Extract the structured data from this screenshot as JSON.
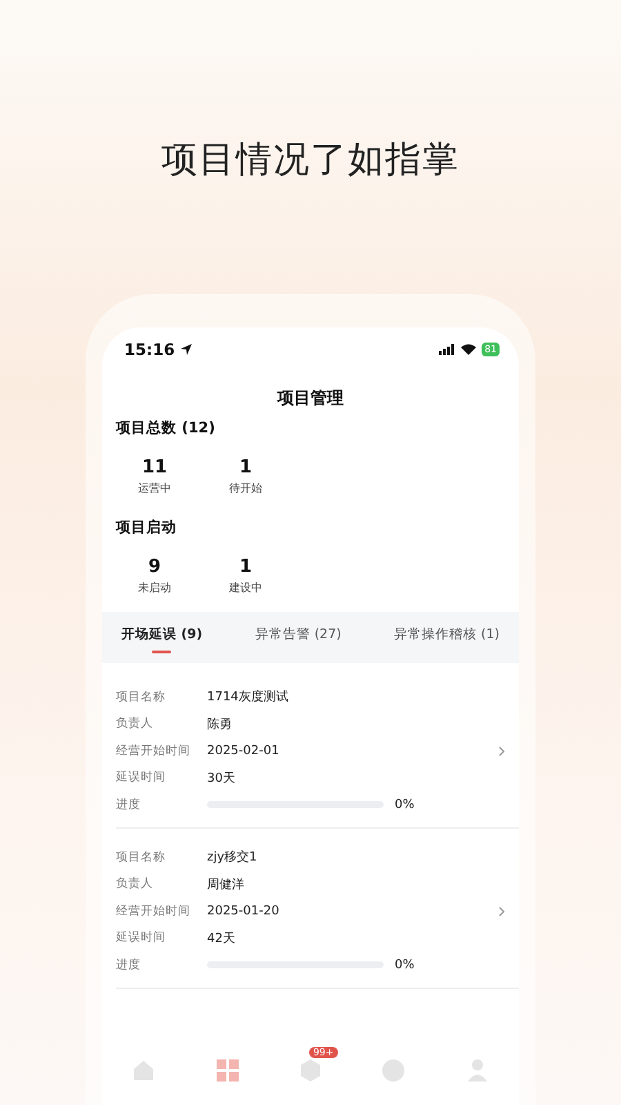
{
  "headline": "项目情况了如指掌",
  "status_bar": {
    "time": "15:16",
    "battery": "81"
  },
  "title": "项目管理",
  "sections": [
    {
      "heading": "项目总数 (12)",
      "stats": [
        {
          "value": "11",
          "label": "运营中"
        },
        {
          "value": "1",
          "label": "待开始"
        }
      ]
    },
    {
      "heading": "项目启动",
      "stats": [
        {
          "value": "9",
          "label": "未启动"
        },
        {
          "value": "1",
          "label": "建设中"
        }
      ]
    }
  ],
  "tabs": [
    {
      "label": "开场延误 (9)",
      "selected": true
    },
    {
      "label": "异常告警 (27)",
      "selected": false
    },
    {
      "label": "异常操作稽核 (1)",
      "selected": false
    }
  ],
  "projects": [
    {
      "fields": [
        {
          "label": "项目名称",
          "value": "1714灰度测试"
        },
        {
          "label": "负责人",
          "value": "陈勇"
        },
        {
          "label": "经营开始时间",
          "value": "2025-02-01"
        },
        {
          "label": "延误时间",
          "value": "30天"
        }
      ],
      "progress_label": "进度",
      "level": 0,
      "reading": "0%"
    },
    {
      "fields": [
        {
          "label": "项目名称",
          "value": "zjy移交1"
        },
        {
          "label": "负责人",
          "value": "周健洋"
        },
        {
          "label": "经营开始时间",
          "value": "2025-01-20"
        },
        {
          "label": "延误时间",
          "value": "42天"
        }
      ],
      "progress_label": "进度",
      "level": 0,
      "reading": "0%"
    }
  ],
  "nav": [
    {
      "kind": "home",
      "selected": false
    },
    {
      "kind": "grid",
      "selected": true
    },
    {
      "kind": "box",
      "selected": false,
      "badge": "99+"
    },
    {
      "kind": "chart",
      "selected": false
    },
    {
      "kind": "user",
      "selected": false
    }
  ]
}
